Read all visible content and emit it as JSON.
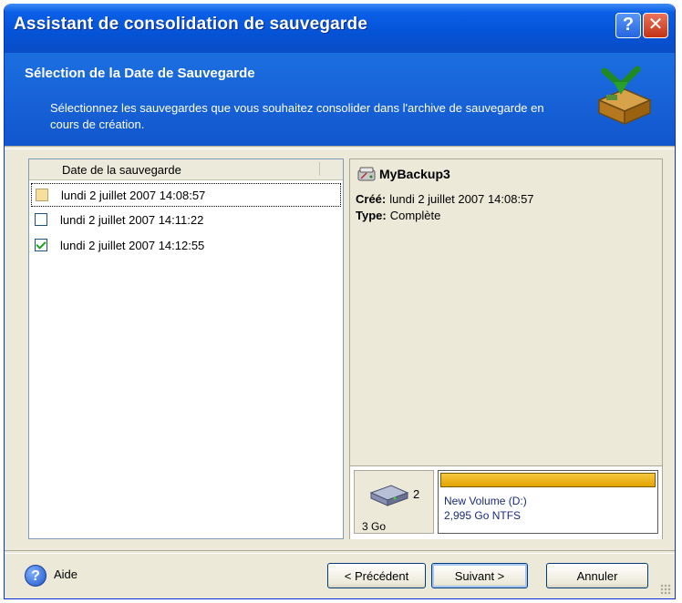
{
  "window": {
    "title": "Assistant de consolidation de sauvegarde"
  },
  "titlebar_buttons": {
    "help": "?",
    "close": "✕"
  },
  "header": {
    "title": "Sélection de la Date de Sauvegarde",
    "description": "Sélectionnez les sauvegardes que vous souhaitez consolider dans l'archive de sauvegarde en cours de création."
  },
  "list": {
    "column_header": "Date de la sauvegarde",
    "items": [
      {
        "label": "lundi 2 juillet 2007 14:08:57",
        "state": "partial"
      },
      {
        "label": "lundi 2 juillet 2007 14:11:22",
        "state": "unchecked"
      },
      {
        "label": "lundi 2 juillet 2007 14:12:55",
        "state": "checked"
      }
    ]
  },
  "details": {
    "name": "MyBackup3",
    "created_label": "Créé:",
    "created_value": "lundi 2 juillet 2007 14:08:57",
    "type_label": "Type:",
    "type_value": "Complète"
  },
  "disk": {
    "number": "2",
    "size": "3 Go",
    "volume_name": "New Volume (D:)",
    "volume_info": "2,995 Go  NTFS"
  },
  "footer": {
    "help": "Aide",
    "previous": "< Précédent",
    "next": "Suivant >",
    "cancel": "Annuler"
  }
}
